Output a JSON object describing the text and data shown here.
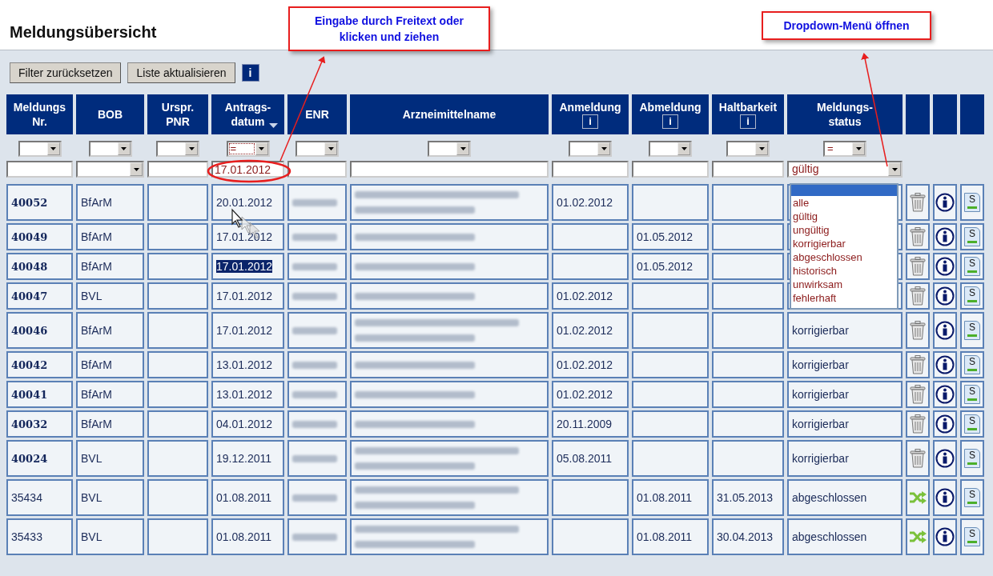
{
  "page": {
    "title": "Meldungsübersicht"
  },
  "annotations": [
    {
      "kind": "callout",
      "text": "Eingabe durch Freitext oder klicken und ziehen"
    },
    {
      "kind": "callout",
      "text": "Dropdown-Menü öffnen"
    }
  ],
  "toolbar": {
    "buttons": [
      "Filter zurücksetzen",
      "Liste aktualisieren"
    ],
    "info": "i"
  },
  "columns": [
    {
      "kind": "data",
      "label": [
        "Meldungs",
        "Nr."
      ],
      "sorted": false,
      "filter": {
        "operator_focused": false,
        "kind": "text"
      }
    },
    {
      "kind": "data",
      "label": [
        "BOB"
      ],
      "sorted": false,
      "filter": {
        "operator_focused": false,
        "kind": "select"
      }
    },
    {
      "kind": "data",
      "label": [
        "Urspr.",
        "PNR"
      ],
      "sorted": false,
      "filter": {
        "operator_focused": false,
        "kind": "text"
      }
    },
    {
      "kind": "data",
      "label": [
        "Antrags-",
        "datum"
      ],
      "sorted": true,
      "filter": {
        "operator": "=",
        "operator_focused": true,
        "kind": "text",
        "value": "17.01.2012"
      }
    },
    {
      "kind": "data",
      "label": [
        "ENR"
      ],
      "sorted": false,
      "filter": {
        "operator_focused": false,
        "kind": "text"
      }
    },
    {
      "kind": "data",
      "label": [
        "Arzneimittelname"
      ],
      "sorted": false,
      "filter": {
        "operator_focused": false,
        "kind": "text"
      }
    },
    {
      "kind": "data",
      "label": [
        "Anmeldung"
      ],
      "sorted": false,
      "info": "i",
      "filter": {
        "operator_focused": false,
        "kind": "text"
      }
    },
    {
      "kind": "data",
      "label": [
        "Abmeldung"
      ],
      "sorted": false,
      "info": "i",
      "filter": {
        "operator_focused": false,
        "kind": "text"
      }
    },
    {
      "kind": "data",
      "label": [
        "Haltbarkeit"
      ],
      "sorted": false,
      "info": "i",
      "filter": {
        "operator_focused": false,
        "kind": "text"
      }
    },
    {
      "kind": "data",
      "label": [
        "Meldungs-",
        "status"
      ],
      "sorted": false,
      "filter": {
        "operator": "=",
        "operator_focused": false,
        "kind": "select",
        "value": "gültig"
      }
    },
    {
      "kind": "action"
    },
    {
      "kind": "action"
    },
    {
      "kind": "action"
    }
  ],
  "rows": [
    {
      "nr": "40052",
      "unread": true,
      "bob": "BfArM",
      "date": "20.01.2012",
      "date_selected": false,
      "name": {
        "kind": "two-line"
      },
      "anmeldung": "01.02.2012",
      "action": {
        "kind": "delete"
      },
      "doc": "S"
    },
    {
      "nr": "40049",
      "unread": true,
      "bob": "BfArM",
      "date": "17.01.2012",
      "date_selected": false,
      "name": {
        "kind": "one-line"
      },
      "abmeldung": "01.05.2012",
      "action": {
        "kind": "delete"
      },
      "doc": "S"
    },
    {
      "nr": "40048",
      "unread": true,
      "bob": "BfArM",
      "date": "17.01.2012",
      "date_selected": true,
      "name": {
        "kind": "one-line"
      },
      "abmeldung": "01.05.2012",
      "action": {
        "kind": "delete"
      },
      "doc": "S"
    },
    {
      "nr": "40047",
      "unread": true,
      "bob": "BVL",
      "date": "17.01.2012",
      "date_selected": false,
      "name": {
        "kind": "one-line"
      },
      "anmeldung": "01.02.2012",
      "action": {
        "kind": "delete"
      },
      "doc": "S"
    },
    {
      "nr": "40046",
      "unread": true,
      "bob": "BfArM",
      "date": "17.01.2012",
      "date_selected": false,
      "name": {
        "kind": "two-line"
      },
      "anmeldung": "01.02.2012",
      "status": "korrigierbar",
      "action": {
        "kind": "delete"
      },
      "doc": "S"
    },
    {
      "nr": "40042",
      "unread": true,
      "bob": "BfArM",
      "date": "13.01.2012",
      "date_selected": false,
      "name": {
        "kind": "one-line"
      },
      "anmeldung": "01.02.2012",
      "status": "korrigierbar",
      "action": {
        "kind": "delete"
      },
      "doc": "S"
    },
    {
      "nr": "40041",
      "unread": true,
      "bob": "BfArM",
      "date": "13.01.2012",
      "date_selected": false,
      "name": {
        "kind": "one-line"
      },
      "anmeldung": "01.02.2012",
      "status": "korrigierbar",
      "action": {
        "kind": "delete"
      },
      "doc": "S"
    },
    {
      "nr": "40032",
      "unread": true,
      "bob": "BfArM",
      "date": "04.01.2012",
      "date_selected": false,
      "name": {
        "kind": "one-line"
      },
      "anmeldung": "20.11.2009",
      "status": "korrigierbar",
      "action": {
        "kind": "delete"
      },
      "doc": "S"
    },
    {
      "nr": "40024",
      "unread": true,
      "bob": "BVL",
      "date": "19.12.2011",
      "date_selected": false,
      "name": {
        "kind": "two-line"
      },
      "anmeldung": "05.08.2011",
      "status": "korrigierbar",
      "action": {
        "kind": "delete"
      },
      "doc": "S"
    },
    {
      "nr": "35434",
      "unread": false,
      "bob": "BVL",
      "date": "01.08.2011",
      "date_selected": false,
      "name": {
        "kind": "two-line"
      },
      "abmeldung": "01.08.2011",
      "haltbarkeit": "31.05.2013",
      "status": "abgeschlossen",
      "action": {
        "kind": "reactivate"
      },
      "doc": "S"
    },
    {
      "nr": "35433",
      "unread": false,
      "bob": "BVL",
      "date": "01.08.2011",
      "date_selected": false,
      "name": {
        "kind": "two-line"
      },
      "abmeldung": "01.08.2011",
      "haltbarkeit": "30.04.2013",
      "status": "abgeschlossen",
      "action": {
        "kind": "reactivate"
      },
      "doc": "S"
    }
  ],
  "status_dropdown": {
    "open": true,
    "blank_selected": true,
    "options": [
      {
        "label": "alle",
        "selected": false
      },
      {
        "label": "gültig",
        "selected": false
      },
      {
        "label": "ungültig",
        "selected": false
      },
      {
        "label": "korrigierbar",
        "selected": false
      },
      {
        "label": "abgeschlossen",
        "selected": false
      },
      {
        "label": "historisch",
        "selected": false
      },
      {
        "label": "unwirksam",
        "selected": false
      },
      {
        "label": "fehlerhaft",
        "selected": false
      }
    ]
  }
}
